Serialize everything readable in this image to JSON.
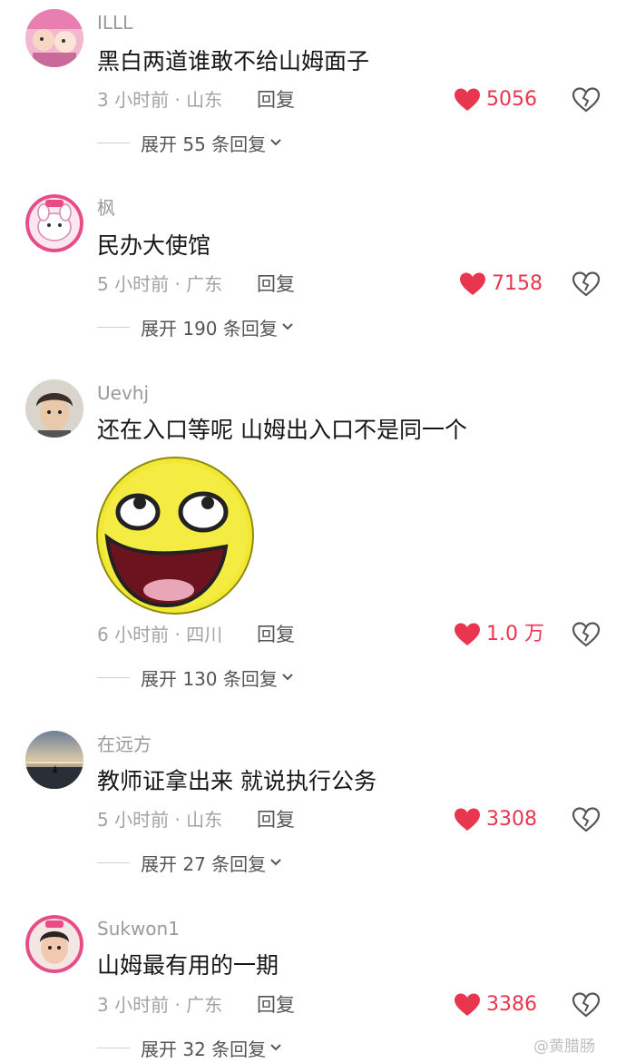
{
  "comments": [
    {
      "username": "ILLL",
      "text": "黑白两道谁敢不给山姆面子",
      "meta": "3 小时前 · 山东",
      "reply": "回复",
      "likes": "5056",
      "expand": "展开 55 条回复"
    },
    {
      "username": "枫",
      "text": "民办大使馆",
      "meta": "5 小时前 · 广东",
      "reply": "回复",
      "likes": "7158",
      "expand": "展开 190 条回复"
    },
    {
      "username": "Uevhj",
      "text": "还在入口等呢 山姆出入口不是同一个",
      "meta": "6 小时前 · 四川",
      "reply": "回复",
      "likes": "1.0 万",
      "expand": "展开 130 条回复"
    },
    {
      "username": "在远方",
      "text": "教师证拿出来 就说执行公务",
      "meta": "5 小时前 · 山东",
      "reply": "回复",
      "likes": "3308",
      "expand": "展开 27 条回复"
    },
    {
      "username": "Sukwon1",
      "text": "山姆最有用的一期",
      "meta": "3 小时前 · 广东",
      "reply": "回复",
      "likes": "3386",
      "expand": "展开 32 条回复"
    }
  ],
  "watermark": "@黄腊肠",
  "colors": {
    "like_red": "#e8364f",
    "username_gray": "#9a9a9a",
    "text_black": "#161616"
  }
}
